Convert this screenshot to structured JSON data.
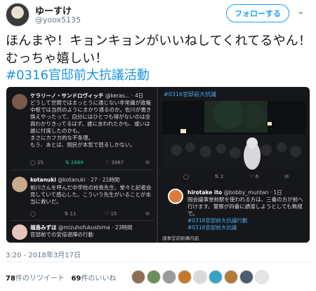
{
  "header": {
    "display_name": "ゆーすけ",
    "handle": "@yoox5135",
    "follow_label": "フォローする",
    "menu_icon": "chevron-down-icon"
  },
  "tweet": {
    "text": "ほんまや！キョンキョンがいいねしてくれてるやん！むっちゃ嬉しい！",
    "hashtag": "#0316官邸前大抗議活動",
    "timestamp": "3:20 - 2018年3月17日"
  },
  "embedded_left": [
    {
      "avatar_color": "#7a5a4a",
      "name": "ケラリーノ・サンドロヴィッチ",
      "handle_time": "@keras... · 4日",
      "body": "どうして世間ではまっとうに通じない非常識が政権中枢では当然のようにまかり通るのか。佐川が書き換えやったって、自分にはひとつも得がないのは全員わかりきってるはず。誰に言われたかも、或いは誰に忖度したのかも。\nまさにカフカ的な不条理。\nもう、あとは、国民が本気で怒るしかない。",
      "actions": [
        "25",
        "2669",
        "3967",
        "✉"
      ]
    },
    {
      "avatar_color": "#c8a98c",
      "name": "kotanuki",
      "handle_time": "@kotanuki · 27 · 21時間",
      "body": "前川さんを呼んだ中学校の校長先生、堂々と記者会見していて感心した。こういう先生がいることが本当に救いだ。",
      "actions": [
        "",
        "11",
        "15",
        "✉"
      ]
    },
    {
      "avatar_color": "#e8c4b8",
      "name": "福島みずほ",
      "handle_time": "@mizuhofukushima · 23時間",
      "body": "官邸前での安倍退陣の行動",
      "actions": []
    }
  ],
  "embedded_right": {
    "top_hashtag": "#0316官邸前大抗議",
    "actions": [
      "2",
      "",
      "6"
    ],
    "name": "hirotake ito",
    "handle_time": "@bobby_muntan · 1日",
    "body": "国会議事堂前駅を使われる方は、三番の方が前へ行けます。警察が四番に誘導しようとしても無視で。",
    "tags": [
      "#0316官邸前大抗議行動",
      "#0316官邸前大抗議"
    ],
    "bottom_caption": "議事堂前駅構内図"
  },
  "stats": {
    "retweets_count": "78",
    "retweets_label": "件のリツイート",
    "likes_count": "69",
    "likes_label": "件のいいね"
  },
  "likers": [
    "#8a6f55",
    "#6b8f5a",
    "#9a9a9a",
    "#c27b2e",
    "#d9d9d9",
    "#3aa3c4",
    "#b37b3a",
    "#4b5b70",
    "#e6e6e6"
  ]
}
